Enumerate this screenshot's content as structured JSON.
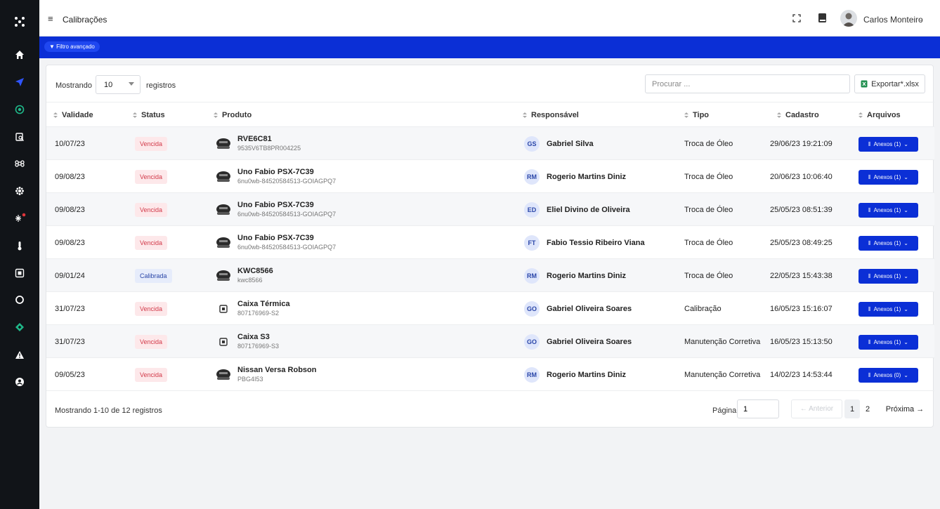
{
  "header": {
    "title": "Calibrações",
    "user_name": "Carlos Monteiro",
    "menu_icon": "≡",
    "caret": "⌄"
  },
  "filter": {
    "label": "Filtro avançado"
  },
  "toolbar": {
    "mostrando_label": "Mostrando",
    "page_size": "10",
    "registros_label": "registros",
    "search_placeholder": "Procurar ...",
    "export_label": "Exportar*.xlsx"
  },
  "columns": [
    "Validade",
    "Status",
    "Produto",
    "Responsável",
    "Tipo",
    "Cadastro",
    "Arquivos"
  ],
  "rows": [
    {
      "validade": "10/07/23",
      "status": "Vencida",
      "produto": "RVE6C81",
      "codigo": "9535V6TB8PR004225",
      "iniciais": "GS",
      "responsavel": "Gabriel Silva",
      "tipo": "Troca de Óleo",
      "cadastro": "29/06/23 19:21:09",
      "anexos": "Anexos (1)"
    },
    {
      "validade": "09/08/23",
      "status": "Vencida",
      "produto": "Uno Fabio PSX-7C39",
      "codigo": "6nu0wb-84520584513-GOIAGPQ7",
      "iniciais": "RM",
      "responsavel": "Rogerio Martins Diniz",
      "tipo": "Troca de Óleo",
      "cadastro": "20/06/23 10:06:40",
      "anexos": "Anexos (1)"
    },
    {
      "validade": "09/08/23",
      "status": "Vencida",
      "produto": "Uno Fabio PSX-7C39",
      "codigo": "6nu0wb-84520584513-GOIAGPQ7",
      "iniciais": "ED",
      "responsavel": "Eliel Divino de Oliveira",
      "tipo": "Troca de Óleo",
      "cadastro": "25/05/23 08:51:39",
      "anexos": "Anexos (1)"
    },
    {
      "validade": "09/08/23",
      "status": "Vencida",
      "produto": "Uno Fabio PSX-7C39",
      "codigo": "6nu0wb-84520584513-GOIAGPQ7",
      "iniciais": "FT",
      "responsavel": "Fabio Tessio Ribeiro Viana",
      "tipo": "Troca de Óleo",
      "cadastro": "25/05/23 08:49:25",
      "anexos": "Anexos (1)"
    },
    {
      "validade": "09/01/24",
      "status": "Calibrada",
      "produto": "KWC8566",
      "codigo": "kwc8566",
      "iniciais": "RM",
      "responsavel": "Rogerio Martins Diniz",
      "tipo": "Troca de Óleo",
      "cadastro": "22/05/23 15:43:38",
      "anexos": "Anexos (1)"
    },
    {
      "validade": "31/07/23",
      "status": "Vencida",
      "produto": "Caixa Térmica",
      "codigo": "807176969-S2",
      "iniciais": "GO",
      "responsavel": "Gabriel Oliveira Soares",
      "tipo": "Calibração",
      "cadastro": "16/05/23 15:16:07",
      "anexos": "Anexos (1)"
    },
    {
      "validade": "31/07/23",
      "status": "Vencida",
      "produto": "Caixa S3",
      "codigo": "807176969-S3",
      "iniciais": "GO",
      "responsavel": "Gabriel Oliveira Soares",
      "tipo": "Manutenção Corretiva",
      "cadastro": "16/05/23 15:13:50",
      "anexos": "Anexos (1)"
    },
    {
      "validade": "09/05/23",
      "status": "Vencida",
      "produto": "Nissan Versa Robson",
      "codigo": "PBG4I53",
      "iniciais": "RM",
      "responsavel": "Rogerio Martins Diniz",
      "tipo": "Manutenção Corretiva",
      "cadastro": "14/02/23 14:53:44",
      "anexos": "Anexos (0)"
    }
  ],
  "footer": {
    "summary": "Mostrando 1-10 de 12 registros",
    "pagina_label": "Página",
    "pagina_value": "1",
    "prev_label": "← Anterior",
    "page1": "1",
    "page2": "2",
    "next_label": "Próxima →"
  },
  "colors": {
    "brand_blue": "#0b2fd6",
    "sidebar_bg": "#111418",
    "vencida": "#d23a4a",
    "calibrada": "#2a46a8",
    "accent_green": "#1fb98a"
  }
}
